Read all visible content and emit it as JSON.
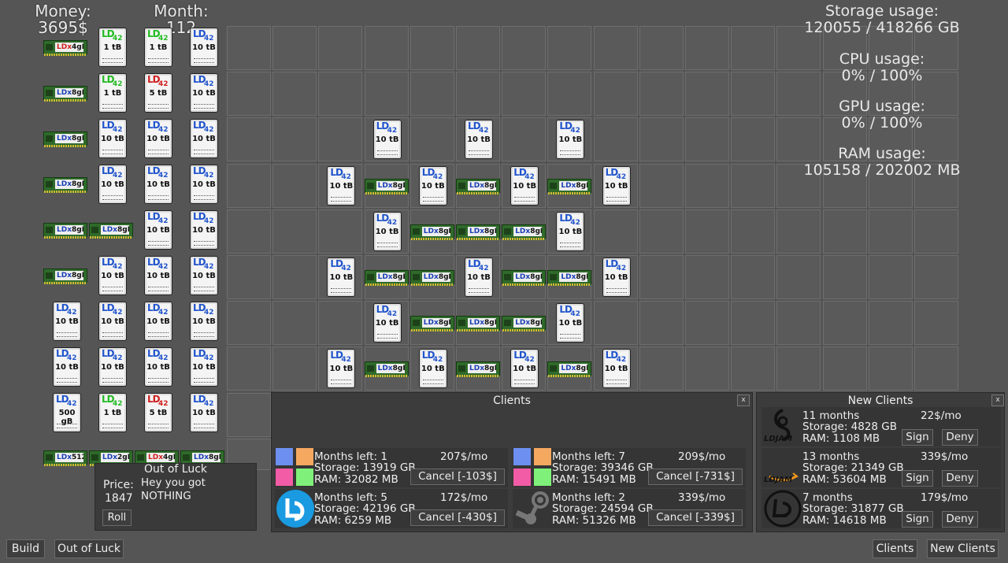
{
  "hud": {
    "money_label": "Money:",
    "money_value": "3695$",
    "month_label": "Month:",
    "month_value": "112"
  },
  "stats": {
    "storage_label": "Storage usage:",
    "storage_value": "120055 / 418266 GB",
    "cpu_label": "CPU usage:",
    "cpu_value": "0% / 100%",
    "gpu_label": "GPU usage:",
    "gpu_value": "0% / 100%",
    "ram_label": "RAM usage:",
    "ram_value": "105158 / 202002 MB"
  },
  "hdd_brand": "LD",
  "hdd_model": "42",
  "ram_brand": "LDx",
  "inventory": [
    {
      "kind": "ram",
      "cap": "4gB",
      "brand_color": "#d02020"
    },
    {
      "kind": "hdd",
      "cap": "1 tB",
      "ld_color": "#22bb22"
    },
    {
      "kind": "hdd",
      "cap": "1 tB",
      "ld_color": "#22bb22"
    },
    {
      "kind": "hdd",
      "cap": "10 tB",
      "ld_color": "#2255cc"
    },
    {
      "kind": "ram",
      "cap": "8gB"
    },
    {
      "kind": "hdd",
      "cap": "1 tB",
      "ld_color": "#22bb22"
    },
    {
      "kind": "hdd",
      "cap": "5 tB",
      "ld_color": "#d02020"
    },
    {
      "kind": "hdd",
      "cap": "10 tB",
      "ld_color": "#2255cc"
    },
    {
      "kind": "ram",
      "cap": "8gB"
    },
    {
      "kind": "hdd",
      "cap": "10 tB",
      "ld_color": "#2255cc"
    },
    {
      "kind": "hdd",
      "cap": "10 tB",
      "ld_color": "#2255cc"
    },
    {
      "kind": "hdd",
      "cap": "10 tB",
      "ld_color": "#2255cc"
    },
    {
      "kind": "ram",
      "cap": "8gB"
    },
    {
      "kind": "hdd",
      "cap": "10 tB",
      "ld_color": "#2255cc"
    },
    {
      "kind": "hdd",
      "cap": "10 tB",
      "ld_color": "#2255cc"
    },
    {
      "kind": "hdd",
      "cap": "10 tB",
      "ld_color": "#2255cc"
    },
    {
      "kind": "ram",
      "cap": "8gB"
    },
    {
      "kind": "ram",
      "cap": "8gB"
    },
    {
      "kind": "hdd",
      "cap": "10 tB",
      "ld_color": "#2255cc"
    },
    {
      "kind": "hdd",
      "cap": "10 tB",
      "ld_color": "#2255cc"
    },
    {
      "kind": "ram",
      "cap": "8gB"
    },
    {
      "kind": "hdd",
      "cap": "10 tB",
      "ld_color": "#2255cc"
    },
    {
      "kind": "hdd",
      "cap": "10 tB",
      "ld_color": "#2255cc"
    },
    {
      "kind": "hdd",
      "cap": "10 tB",
      "ld_color": "#2255cc"
    },
    {
      "kind": "hdd",
      "cap": "10 tB",
      "ld_color": "#2255cc"
    },
    {
      "kind": "hdd",
      "cap": "10 tB",
      "ld_color": "#2255cc"
    },
    {
      "kind": "hdd",
      "cap": "10 tB",
      "ld_color": "#2255cc"
    },
    {
      "kind": "hdd",
      "cap": "10 tB",
      "ld_color": "#2255cc"
    },
    {
      "kind": "hdd",
      "cap": "10 tB",
      "ld_color": "#2255cc"
    },
    {
      "kind": "hdd",
      "cap": "10 tB",
      "ld_color": "#2255cc"
    },
    {
      "kind": "hdd",
      "cap": "10 tB",
      "ld_color": "#2255cc"
    },
    {
      "kind": "hdd",
      "cap": "10 tB",
      "ld_color": "#2255cc"
    },
    {
      "kind": "hdd",
      "cap": "500 gB",
      "ld_color": "#2255cc"
    },
    {
      "kind": "hdd",
      "cap": "1 tB",
      "ld_color": "#22bb22"
    },
    {
      "kind": "hdd",
      "cap": "5 tB",
      "ld_color": "#d02020"
    },
    {
      "kind": "hdd",
      "cap": "10 tB",
      "ld_color": "#2255cc"
    },
    {
      "kind": "ram",
      "cap": "512 MB"
    },
    {
      "kind": "ram",
      "cap": "2gB"
    },
    {
      "kind": "ram",
      "cap": "4gB",
      "brand_color": "#d02020"
    },
    {
      "kind": "ram",
      "cap": "8gB"
    }
  ],
  "servers": [
    {
      "kind": "hdd",
      "cap": "10 tB",
      "ld_color": "#2255cc"
    },
    {
      "kind": "hdd",
      "cap": "10 tB",
      "ld_color": "#2255cc"
    },
    {
      "kind": "hdd",
      "cap": "10 tB",
      "ld_color": "#2255cc"
    },
    {
      "kind": "hdd",
      "cap": "10 tB",
      "ld_color": "#2255cc"
    },
    {
      "kind": "ram",
      "cap": "8gB"
    },
    {
      "kind": "hdd",
      "cap": "10 tB",
      "ld_color": "#2255cc"
    },
    {
      "kind": "ram",
      "cap": "8gB"
    },
    {
      "kind": "hdd",
      "cap": "10 tB",
      "ld_color": "#2255cc"
    },
    {
      "kind": "ram",
      "cap": "8gB"
    },
    {
      "kind": "hdd",
      "cap": "10 tB",
      "ld_color": "#2255cc"
    },
    {
      "kind": "hdd",
      "cap": "10 tB",
      "ld_color": "#2255cc"
    },
    {
      "kind": "ram",
      "cap": "8gB"
    },
    {
      "kind": "ram",
      "cap": "8gB"
    },
    {
      "kind": "ram",
      "cap": "8gB"
    },
    {
      "kind": "hdd",
      "cap": "10 tB",
      "ld_color": "#2255cc"
    },
    {
      "kind": "hdd",
      "cap": "10 tB",
      "ld_color": "#2255cc"
    },
    {
      "kind": "ram",
      "cap": "8gB"
    },
    {
      "kind": "ram",
      "cap": "8gB"
    },
    {
      "kind": "hdd",
      "cap": "10 tB",
      "ld_color": "#2255cc"
    },
    {
      "kind": "ram",
      "cap": "8gB"
    },
    {
      "kind": "ram",
      "cap": "8gB"
    },
    {
      "kind": "hdd",
      "cap": "10 tB",
      "ld_color": "#2255cc"
    },
    {
      "kind": "hdd",
      "cap": "10 tB",
      "ld_color": "#2255cc"
    },
    {
      "kind": "ram",
      "cap": "8gB"
    },
    {
      "kind": "ram",
      "cap": "8gB"
    },
    {
      "kind": "ram",
      "cap": "8gB"
    },
    {
      "kind": "hdd",
      "cap": "10 tB",
      "ld_color": "#2255cc"
    },
    {
      "kind": "hdd",
      "cap": "10 tB",
      "ld_color": "#2255cc"
    },
    {
      "kind": "ram",
      "cap": "8gB"
    },
    {
      "kind": "hdd",
      "cap": "10 tB",
      "ld_color": "#2255cc"
    },
    {
      "kind": "ram",
      "cap": "8gB"
    },
    {
      "kind": "hdd",
      "cap": "10 tB",
      "ld_color": "#2255cc"
    },
    {
      "kind": "ram",
      "cap": "8gB"
    },
    {
      "kind": "hdd",
      "cap": "10 tB",
      "ld_color": "#2255cc"
    }
  ],
  "roll": {
    "title": "Out of Luck",
    "price_label": "Price:",
    "price_value": "1847",
    "message": "Hey you got\nNOTHING",
    "roll_button": "Roll"
  },
  "clients_panel": {
    "title": "Clients",
    "close": "x",
    "clients": [
      {
        "months": "Months left: 1",
        "storage": "Storage: 13919 GB",
        "ram": "RAM: 32082 MB",
        "price": "207$/mo",
        "cancel": "Cancel [-103$]",
        "icon": "color-squares-icon"
      },
      {
        "months": "Months left: 7",
        "storage": "Storage: 39346 GB",
        "ram": "RAM: 15491 MB",
        "price": "209$/mo",
        "cancel": "Cancel [-731$]",
        "icon": "color-squares-icon"
      },
      {
        "months": "Months left: 5",
        "storage": "Storage: 42196 GB",
        "ram": "RAM: 6259 MB",
        "price": "172$/mo",
        "cancel": "Cancel [-430$]",
        "icon": "ld-logo-icon"
      },
      {
        "months": "Months left: 2",
        "storage": "Storage: 24594 GB",
        "ram": "RAM: 51326 MB",
        "price": "339$/mo",
        "cancel": "Cancel [-339$]",
        "icon": "steam-logo-icon"
      }
    ]
  },
  "new_clients_panel": {
    "title": "New Clients",
    "close": "x",
    "clients": [
      {
        "months": "11 months",
        "storage": "Storage: 4828 GB",
        "ram": "RAM: 1108 MB",
        "price": "22$/mo",
        "sign": "Sign",
        "deny": "Deny",
        "icon": "ldjam-logo-icon",
        "logo_text": "LDJAM"
      },
      {
        "months": "13 months",
        "storage": "Storage: 21349 GB",
        "ram": "RAM: 53604 MB",
        "price": "339$/mo",
        "sign": "Sign",
        "deny": "Deny",
        "icon": "ldjam-amazon-logo-icon",
        "logo_text": "LDJAM"
      },
      {
        "months": "7 months",
        "storage": "Storage: 31877 GB",
        "ram": "RAM: 14618 MB",
        "price": "179$/mo",
        "sign": "Sign",
        "deny": "Deny",
        "icon": "ld-circle-logo-icon",
        "logo_text": ""
      }
    ]
  },
  "bottom_bar": {
    "build": "Build",
    "out_of_luck": "Out of Luck",
    "clients": "Clients",
    "new_clients": "New Clients"
  }
}
